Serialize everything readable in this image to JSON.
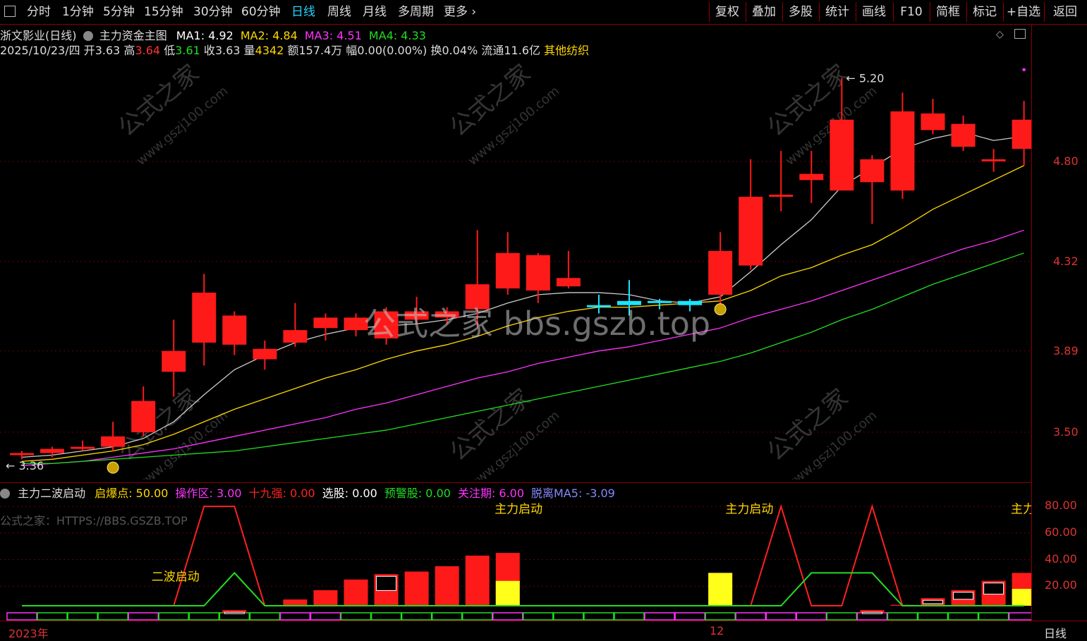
{
  "toolbar": {
    "left_tabs": [
      "分时",
      "1分钟",
      "5分钟",
      "15分钟",
      "30分钟",
      "60分钟",
      "日线",
      "周线",
      "月线",
      "多周期",
      "更多"
    ],
    "active_tab": "日线",
    "right_buttons": [
      "复权",
      "叠加",
      "多股",
      "统计",
      "画线",
      "F10",
      "简框",
      "标记",
      "+自选",
      "返回"
    ]
  },
  "main": {
    "stock_title": "浙文影业(日线)",
    "indicator_name": "主力资金主图",
    "ma": [
      {
        "label": "MA1: 4.92",
        "color": "#ffffff"
      },
      {
        "label": "MA2: 4.84",
        "color": "#ffd700"
      },
      {
        "label": "MA3: 4.51",
        "color": "#ff33ff"
      },
      {
        "label": "MA4: 4.33",
        "color": "#22dd22"
      }
    ],
    "quote": {
      "date": "2025/10/23/四",
      "open_label": "开",
      "open": "3.63",
      "high_label": "高",
      "high": "3.64",
      "low_label": "低",
      "low": "3.61",
      "close_label": "收",
      "close": "3.63",
      "vol_label": "量",
      "vol": "4342",
      "amount": "额157.4万",
      "change": "幅0.00(0.00%)",
      "turnover": "换0.04%",
      "float": "流通11.6亿",
      "sector": "其他纺织"
    },
    "price_labels": [
      "4.80",
      "4.32",
      "3.89",
      "3.50"
    ],
    "high_marker": "5.20",
    "low_marker": "3.36"
  },
  "sub": {
    "indicator_name": "主力二波启动",
    "params": [
      {
        "label": "启爆点: 50.00",
        "color": "#ffd700"
      },
      {
        "label": "操作区: 3.00",
        "color": "#ff33ff"
      },
      {
        "label": "十九强: 0.00",
        "color": "#ff2222"
      },
      {
        "label": "选股: 0.00",
        "color": "#ffffff"
      },
      {
        "label": "预警股: 0.00",
        "color": "#22dd22"
      },
      {
        "label": "关注期: 6.00",
        "color": "#ff33ff"
      },
      {
        "label": "脱离MA5: -3.09",
        "color": "#8888ff"
      }
    ],
    "watermark_text": "公式之家：HTTPS://BBS.GSZB.TOP",
    "axis_labels": [
      "80.00",
      "60.00",
      "40.00",
      "20.00"
    ],
    "annotations": [
      "二波启动",
      "主力启动",
      "主力启动",
      "主力"
    ]
  },
  "bottom": {
    "year": "2023年",
    "month": "12",
    "period": "日线"
  },
  "watermarks": {
    "center": "公式之家 bbs.gszb.top",
    "repeat": "公式之家",
    "url": "www.gszj100.com"
  },
  "chart_data": {
    "type": "candlestick",
    "candles": [
      {
        "o": 3.39,
        "c": 3.4,
        "h": 3.41,
        "l": 3.37
      },
      {
        "o": 3.4,
        "c": 3.42,
        "h": 3.43,
        "l": 3.38
      },
      {
        "o": 3.42,
        "c": 3.43,
        "h": 3.46,
        "l": 3.41
      },
      {
        "o": 3.43,
        "c": 3.48,
        "h": 3.55,
        "l": 3.41
      },
      {
        "o": 3.5,
        "c": 3.65,
        "h": 3.72,
        "l": 3.48
      },
      {
        "o": 3.79,
        "c": 3.89,
        "h": 4.04,
        "l": 3.67
      },
      {
        "o": 3.93,
        "c": 4.17,
        "h": 4.26,
        "l": 3.82
      },
      {
        "o": 3.92,
        "c": 4.06,
        "h": 4.08,
        "l": 3.87
      },
      {
        "o": 3.85,
        "c": 3.9,
        "h": 3.94,
        "l": 3.8
      },
      {
        "o": 3.93,
        "c": 3.99,
        "h": 4.12,
        "l": 3.91
      },
      {
        "o": 4.0,
        "c": 4.05,
        "h": 4.07,
        "l": 3.94
      },
      {
        "o": 3.99,
        "c": 4.05,
        "h": 4.07,
        "l": 3.96
      },
      {
        "o": 3.95,
        "c": 4.08,
        "h": 4.1,
        "l": 3.92
      },
      {
        "o": 4.04,
        "c": 4.08,
        "h": 4.15,
        "l": 4.02
      },
      {
        "o": 4.05,
        "c": 4.08,
        "h": 4.1,
        "l": 4.02
      },
      {
        "o": 4.09,
        "c": 4.21,
        "h": 4.47,
        "l": 4.0
      },
      {
        "o": 4.19,
        "c": 4.36,
        "h": 4.46,
        "l": 4.16
      },
      {
        "o": 4.18,
        "c": 4.35,
        "h": 4.36,
        "l": 4.12
      },
      {
        "o": 4.2,
        "c": 4.24,
        "h": 4.37,
        "l": 4.19
      },
      {
        "o": 4.11,
        "c": 4.1,
        "h": 4.16,
        "l": 4.07
      },
      {
        "o": 4.13,
        "c": 4.11,
        "h": 4.23,
        "l": 4.06
      },
      {
        "o": 4.13,
        "c": 4.12,
        "h": 4.14,
        "l": 4.09
      },
      {
        "o": 4.13,
        "c": 4.11,
        "h": 4.14,
        "l": 4.08
      },
      {
        "o": 4.16,
        "c": 4.37,
        "h": 4.46,
        "l": 4.11
      },
      {
        "o": 4.3,
        "c": 4.63,
        "h": 4.81,
        "l": 4.28
      },
      {
        "o": 4.63,
        "c": 4.64,
        "h": 4.85,
        "l": 4.56
      },
      {
        "o": 4.71,
        "c": 4.74,
        "h": 4.85,
        "l": 4.6
      },
      {
        "o": 4.66,
        "c": 5.0,
        "h": 5.2,
        "l": 4.66
      },
      {
        "o": 4.7,
        "c": 4.81,
        "h": 4.83,
        "l": 4.5
      },
      {
        "o": 4.66,
        "c": 5.04,
        "h": 5.13,
        "l": 4.62
      },
      {
        "o": 4.95,
        "c": 5.03,
        "h": 5.1,
        "l": 4.93
      },
      {
        "o": 4.87,
        "c": 4.98,
        "h": 5.02,
        "l": 4.85
      },
      {
        "o": 4.8,
        "c": 4.81,
        "h": 4.86,
        "l": 4.75
      },
      {
        "o": 4.86,
        "c": 5.0,
        "h": 5.09,
        "l": 4.78
      }
    ],
    "ma_series": [
      {
        "color": "#cccccc",
        "values": [
          3.38,
          3.39,
          3.41,
          3.43,
          3.47,
          3.55,
          3.68,
          3.8,
          3.87,
          3.93,
          3.97,
          4.0,
          4.01,
          4.02,
          4.04,
          4.07,
          4.12,
          4.16,
          4.17,
          4.17,
          4.16,
          4.13,
          4.12,
          4.15,
          4.27,
          4.4,
          4.52,
          4.68,
          4.77,
          4.86,
          4.91,
          4.94,
          4.9,
          4.92
        ]
      },
      {
        "color": "#ffd700",
        "values": [
          3.36,
          3.37,
          3.39,
          3.41,
          3.44,
          3.49,
          3.55,
          3.61,
          3.66,
          3.71,
          3.76,
          3.8,
          3.85,
          3.89,
          3.92,
          3.96,
          4.01,
          4.05,
          4.08,
          4.1,
          4.1,
          4.11,
          4.12,
          4.13,
          4.18,
          4.25,
          4.29,
          4.35,
          4.4,
          4.48,
          4.57,
          4.64,
          4.71,
          4.78
        ]
      },
      {
        "color": "#ff33ff",
        "values": [
          3.34,
          3.35,
          3.36,
          3.38,
          3.4,
          3.42,
          3.45,
          3.48,
          3.51,
          3.54,
          3.57,
          3.61,
          3.64,
          3.68,
          3.72,
          3.76,
          3.79,
          3.83,
          3.86,
          3.89,
          3.91,
          3.94,
          3.97,
          4.0,
          4.05,
          4.09,
          4.13,
          4.18,
          4.23,
          4.28,
          4.33,
          4.38,
          4.42,
          4.47
        ]
      },
      {
        "color": "#22dd22",
        "values": [
          3.35,
          3.35,
          3.36,
          3.37,
          3.38,
          3.39,
          3.4,
          3.41,
          3.43,
          3.45,
          3.47,
          3.49,
          3.51,
          3.54,
          3.57,
          3.6,
          3.63,
          3.66,
          3.69,
          3.72,
          3.75,
          3.78,
          3.81,
          3.84,
          3.88,
          3.93,
          3.98,
          4.04,
          4.09,
          4.15,
          4.21,
          4.26,
          4.31,
          4.36
        ]
      }
    ],
    "sub_red_line": [
      0,
      0,
      0,
      0,
      0,
      0,
      80,
      80,
      0,
      0,
      0,
      0,
      0,
      0,
      0,
      0,
      0,
      0,
      0,
      0,
      0,
      0,
      0,
      0,
      0,
      80,
      0,
      0,
      80,
      0,
      0,
      0,
      0,
      0
    ],
    "sub_green_line": [
      0,
      0,
      0,
      0,
      0,
      0,
      0,
      30,
      0,
      0,
      0,
      0,
      0,
      0,
      0,
      0,
      0,
      0,
      0,
      0,
      0,
      0,
      0,
      0,
      0,
      0,
      30,
      30,
      30,
      0,
      0,
      0,
      0,
      0
    ],
    "sub_bars": [
      {
        "v": 0
      },
      {
        "v": 0
      },
      {
        "v": 0
      },
      {
        "v": 0
      },
      {
        "v": 0
      },
      {
        "v": 0
      },
      {
        "v": 0
      },
      {
        "v": 2,
        "hollow": true
      },
      {
        "v": 5
      },
      {
        "v": 10
      },
      {
        "v": 17
      },
      {
        "v": 25
      },
      {
        "v": 29,
        "hollow": true
      },
      {
        "v": 31
      },
      {
        "v": 35
      },
      {
        "v": 43
      },
      {
        "v": 45,
        "yellow": 24
      },
      {
        "v": 0
      },
      {
        "v": 0
      },
      {
        "v": 0
      },
      {
        "v": 0
      },
      {
        "v": 0
      },
      {
        "v": 0
      },
      {
        "v": 30,
        "yellow": 30
      },
      {
        "v": 0
      },
      {
        "v": 0
      },
      {
        "v": 0
      },
      {
        "v": 0
      },
      {
        "v": 2,
        "hollow": true
      },
      {
        "v": 6
      },
      {
        "v": 11,
        "hollow": true
      },
      {
        "v": 17,
        "hollow": true
      },
      {
        "v": 24,
        "hollow": true
      },
      {
        "v": 30,
        "yellow": 18
      }
    ],
    "price_ylim": [
      3.3,
      5.28
    ],
    "sub_ylim": [
      0,
      88
    ]
  }
}
